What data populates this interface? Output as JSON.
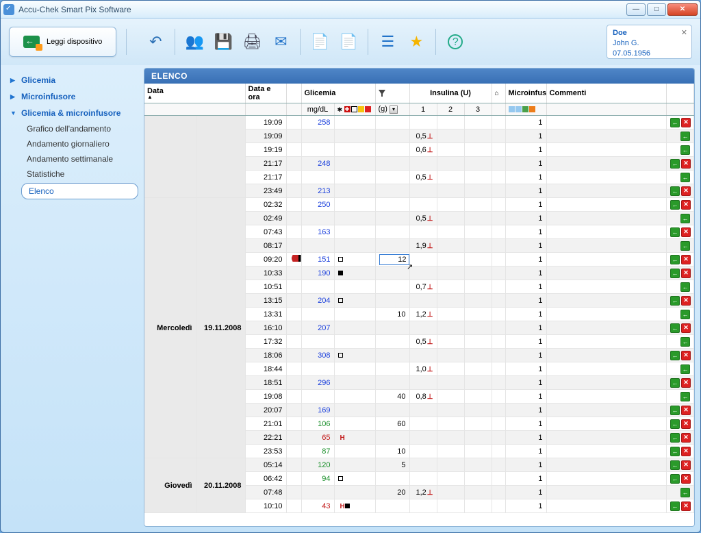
{
  "window": {
    "title": "Accu-Chek Smart Pix Software"
  },
  "toolbar": {
    "read_device": "Leggi dispositivo"
  },
  "patient": {
    "last": "Doe",
    "first": "John G.",
    "dob": "07.05.1956"
  },
  "sidebar": {
    "bg": "Glicemia",
    "pump": "Microinfusore",
    "combo": "Glicemia & microinfusore",
    "sub": {
      "trend": "Grafico dell'andamento",
      "daily": "Andamento giornaliero",
      "weekly": "Andamento settimanale",
      "stats": "Statistiche",
      "list": "Elenco"
    }
  },
  "content": {
    "title": "ELENCO"
  },
  "columns": {
    "data": "Data",
    "dataora": "Data e ora",
    "glicemia": "Glicemia",
    "mgdl": "mg/dL",
    "carbs_g": "(g)",
    "insulin": "Insulina (U)",
    "ins1": "1",
    "ins2": "2",
    "ins3": "3",
    "micro": "Microinfus",
    "commenti": "Commenti"
  },
  "edit_value": "12",
  "days": [
    {
      "label": "",
      "date": "",
      "rows": [
        {
          "t": "19:09",
          "bg": 258,
          "cls": "",
          "m": "",
          "c": "",
          "i1": "",
          "mi": 1,
          "act": "gr"
        },
        {
          "t": "19:09",
          "bg": "",
          "cls": "",
          "m": "",
          "c": "",
          "i1": "0,5",
          "mi": 1,
          "act": "g"
        },
        {
          "t": "19:19",
          "bg": "",
          "cls": "",
          "m": "",
          "c": "",
          "i1": "0,6",
          "mi": 1,
          "act": "g"
        },
        {
          "t": "21:17",
          "bg": 248,
          "cls": "",
          "m": "",
          "c": "",
          "i1": "",
          "mi": 1,
          "act": "gr"
        },
        {
          "t": "21:17",
          "bg": "",
          "cls": "",
          "m": "",
          "c": "",
          "i1": "0,5",
          "mi": 1,
          "act": "g"
        },
        {
          "t": "23:49",
          "bg": 213,
          "cls": "",
          "m": "",
          "c": "",
          "i1": "",
          "mi": 1,
          "act": "gr"
        }
      ]
    },
    {
      "label": "Mercoledì",
      "date": "19.11.2008",
      "rows": [
        {
          "t": "02:32",
          "bg": 250,
          "cls": "",
          "m": "",
          "c": "",
          "i1": "",
          "mi": 1,
          "act": "gr"
        },
        {
          "t": "02:49",
          "bg": "",
          "cls": "",
          "m": "",
          "c": "",
          "i1": "0,5",
          "mi": 1,
          "act": "g"
        },
        {
          "t": "07:43",
          "bg": 163,
          "cls": "",
          "m": "",
          "c": "",
          "i1": "",
          "mi": 1,
          "act": "gr"
        },
        {
          "t": "08:17",
          "bg": "",
          "cls": "",
          "m": "",
          "c": "",
          "i1": "1,9",
          "mi": 1,
          "act": "g"
        },
        {
          "t": "09:20",
          "bg": 151,
          "cls": "",
          "m": "e",
          "c": "edit",
          "i1": "",
          "mi": 1,
          "act": "gr",
          "pencil": true
        },
        {
          "t": "10:33",
          "bg": 190,
          "cls": "",
          "m": "f",
          "c": "",
          "i1": "",
          "mi": 1,
          "act": "gr"
        },
        {
          "t": "10:51",
          "bg": "",
          "cls": "",
          "m": "",
          "c": "",
          "i1": "0,7",
          "mi": 1,
          "act": "g"
        },
        {
          "t": "13:15",
          "bg": 204,
          "cls": "",
          "m": "e",
          "c": "",
          "i1": "",
          "mi": 1,
          "act": "gr"
        },
        {
          "t": "13:31",
          "bg": "",
          "cls": "",
          "m": "",
          "c": "10",
          "i1": "1,2",
          "mi": 1,
          "act": "g"
        },
        {
          "t": "16:10",
          "bg": 207,
          "cls": "",
          "m": "",
          "c": "",
          "i1": "",
          "mi": 1,
          "act": "gr"
        },
        {
          "t": "17:32",
          "bg": "",
          "cls": "",
          "m": "",
          "c": "",
          "i1": "0,5",
          "mi": 1,
          "act": "g"
        },
        {
          "t": "18:06",
          "bg": 308,
          "cls": "",
          "m": "e",
          "c": "",
          "i1": "",
          "mi": 1,
          "act": "gr"
        },
        {
          "t": "18:44",
          "bg": "",
          "cls": "",
          "m": "",
          "c": "",
          "i1": "1,0",
          "mi": 1,
          "act": "g"
        },
        {
          "t": "18:51",
          "bg": 296,
          "cls": "",
          "m": "",
          "c": "",
          "i1": "",
          "mi": 1,
          "act": "gr"
        },
        {
          "t": "19:08",
          "bg": "",
          "cls": "",
          "m": "",
          "c": "40",
          "i1": "0,8",
          "mi": 1,
          "act": "g"
        },
        {
          "t": "20:07",
          "bg": 169,
          "cls": "",
          "m": "",
          "c": "",
          "i1": "",
          "mi": 1,
          "act": "gr"
        },
        {
          "t": "21:01",
          "bg": 106,
          "cls": "lowg",
          "m": "",
          "c": "60",
          "i1": "",
          "mi": 1,
          "act": "gr"
        },
        {
          "t": "22:21",
          "bg": 65,
          "cls": "low",
          "m": "",
          "c": "",
          "i1": "",
          "mi": 1,
          "act": "gr",
          "H": true
        },
        {
          "t": "23:53",
          "bg": 87,
          "cls": "lowg",
          "m": "",
          "c": "10",
          "i1": "",
          "mi": 1,
          "act": "gr"
        }
      ]
    },
    {
      "label": "Giovedì",
      "date": "20.11.2008",
      "rows": [
        {
          "t": "05:14",
          "bg": 120,
          "cls": "lowg",
          "m": "",
          "c": "5",
          "i1": "",
          "mi": 1,
          "act": "gr"
        },
        {
          "t": "06:42",
          "bg": 94,
          "cls": "lowg",
          "m": "e",
          "c": "",
          "i1": "",
          "mi": 1,
          "act": "gr"
        },
        {
          "t": "07:48",
          "bg": "",
          "cls": "",
          "m": "",
          "c": "20",
          "i1": "1,2",
          "mi": 1,
          "act": "g"
        },
        {
          "t": "10:10",
          "bg": 43,
          "cls": "low",
          "m": "f",
          "c": "",
          "i1": "",
          "mi": 1,
          "act": "gr",
          "H": true
        }
      ]
    }
  ]
}
